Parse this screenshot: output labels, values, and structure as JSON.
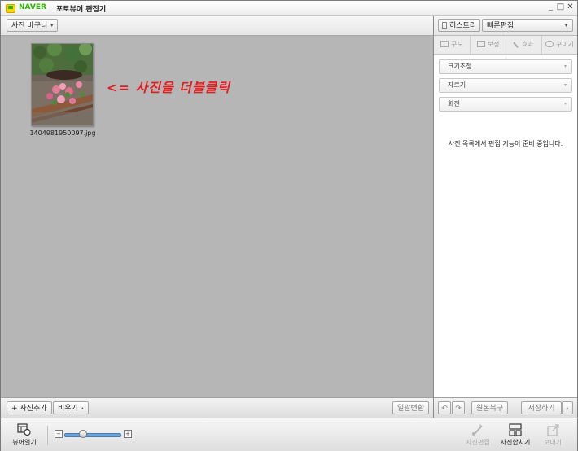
{
  "titlebar": {
    "brand": "NAVER",
    "title": "포토뷰어 편집기",
    "title_caret": "▾",
    "min": "_",
    "max": "□",
    "close": "✕"
  },
  "left_toolbar": {
    "basket_label": "사진 바구니",
    "basket_caret": "▾"
  },
  "thumbnail": {
    "filename": "1404981950097.jpg"
  },
  "hint": "<= 사진을 더블클릭",
  "left_bottom": {
    "add_label": "+ 사진추가",
    "clear_label": "비우기",
    "clear_caret": "▴",
    "batch_label": "일괄변환"
  },
  "right_toolbar": {
    "history_label": "히스토리",
    "quick_edit_label": "빠른편집",
    "quick_edit_caret": "▾"
  },
  "tabs": [
    {
      "label": "구도"
    },
    {
      "label": "보정"
    },
    {
      "label": "효과"
    },
    {
      "label": "꾸미기"
    }
  ],
  "dropdowns": [
    {
      "label": "크기조정",
      "caret": "▾"
    },
    {
      "label": "자르기",
      "caret": "▾"
    },
    {
      "label": "회전",
      "caret": "▾"
    }
  ],
  "notice": "사진 목록에서 편집 기능이 준비 중입니다.",
  "right_bottom": {
    "undo": "↶",
    "redo": "↷",
    "restore_label": "원본복구",
    "save_label": "저장하기",
    "save_caret": "▴"
  },
  "footer": {
    "viewer_label": "뷰어열기",
    "zoom_level": 0.32,
    "zoom_out_glyph": "−",
    "zoom_in_glyph": "+",
    "edit_label": "사진편집",
    "merge_label": "사진합치기",
    "send_label": "보내기"
  },
  "colors": {
    "brand": "#2db400",
    "workspace": "#b6b6b6",
    "hint": "#e02020",
    "slider": "#6aa3d8"
  }
}
